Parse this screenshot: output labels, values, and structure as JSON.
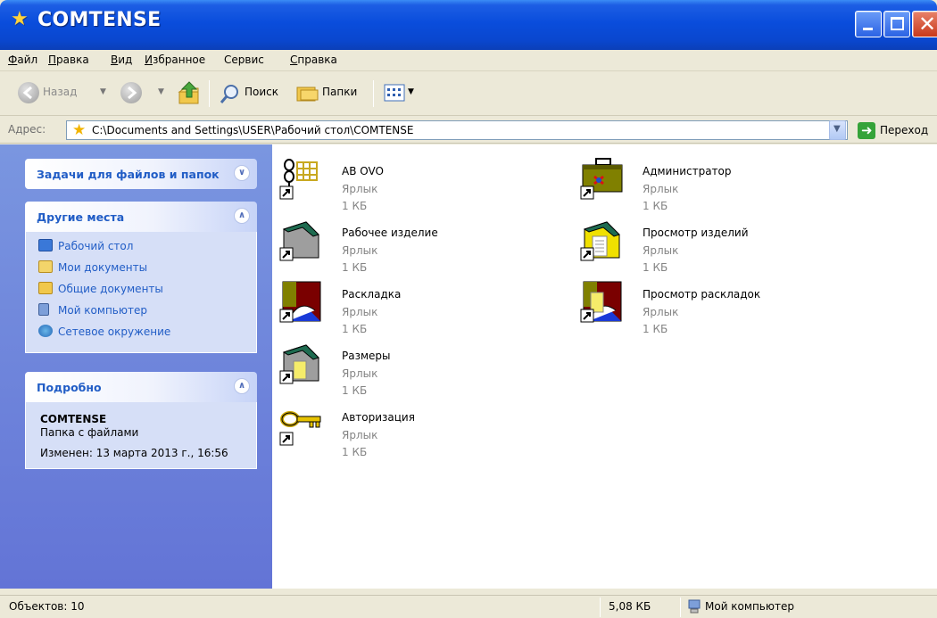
{
  "window": {
    "title": "COMTENSE"
  },
  "menu": [
    {
      "label": "Файл",
      "accel": "Ф",
      "rest": "айл"
    },
    {
      "label": "Правка",
      "accel": "П",
      "rest": "равка"
    },
    {
      "label": "Вид",
      "accel": "В",
      "rest": "ид"
    },
    {
      "label": "Избранное",
      "accel": "И",
      "rest": "збранное"
    },
    {
      "label": "Сервис",
      "accel": "",
      "rest": "Сервис"
    },
    {
      "label": "Справка",
      "accel": "С",
      "rest": "правка"
    }
  ],
  "toolbar": {
    "back_label": "Назад",
    "search_label": "Поиск",
    "folders_label": "Папки"
  },
  "address": {
    "label": "Адрес:",
    "path": "C:\\Documents and Settings\\USER\\Рабочий стол\\COMTENSE",
    "go_label": "Переход"
  },
  "taskpane": {
    "tasks": {
      "title": "Задачи для файлов и папок",
      "expanded": false
    },
    "places": {
      "title": "Другие места",
      "links": [
        {
          "label": "Рабочий стол",
          "icon": "desktop-icon"
        },
        {
          "label": "Мои документы",
          "icon": "my-documents-icon"
        },
        {
          "label": "Общие документы",
          "icon": "shared-documents-icon"
        },
        {
          "label": "Мой компьютер",
          "icon": "my-computer-icon"
        },
        {
          "label": "Сетевое окружение",
          "icon": "network-places-icon"
        }
      ]
    },
    "details": {
      "title": "Подробно",
      "name": "COMTENSE",
      "type": "Папка с файлами",
      "modified": "Изменен: 13 марта 2013 г., 16:56"
    }
  },
  "files": [
    {
      "name": "AB OVO",
      "type": "Ярлык",
      "size": "1 КБ",
      "icon": "ab-ovo-icon"
    },
    {
      "name": "Администратор",
      "type": "Ярлык",
      "size": "1 КБ",
      "icon": "administrator-briefcase-icon"
    },
    {
      "name": "Рабочее изделие",
      "type": "Ярлык",
      "size": "1 КБ",
      "icon": "work-product-icon"
    },
    {
      "name": "Просмотр изделий",
      "type": "Ярлык",
      "size": "1 КБ",
      "icon": "view-products-icon"
    },
    {
      "name": "Раскладка",
      "type": "Ярлык",
      "size": "1 КБ",
      "icon": "layout-icon"
    },
    {
      "name": "Просмотр раскладок",
      "type": "Ярлык",
      "size": "1 КБ",
      "icon": "view-layouts-icon"
    },
    {
      "name": "Размеры",
      "type": "Ярлык",
      "size": "1 КБ",
      "icon": "sizes-icon"
    },
    {
      "name": "Авторизация",
      "type": "Ярлык",
      "size": "1 КБ",
      "icon": "authorization-key-icon"
    }
  ],
  "status": {
    "count": "Объектов: 10",
    "size": "5,08 КБ",
    "zone": "Мой компьютер"
  },
  "colors": {
    "titlebar": "#0a4ddc",
    "taskpane": "#6e86dc",
    "link": "#215dc6",
    "muted_text": "#848484"
  }
}
